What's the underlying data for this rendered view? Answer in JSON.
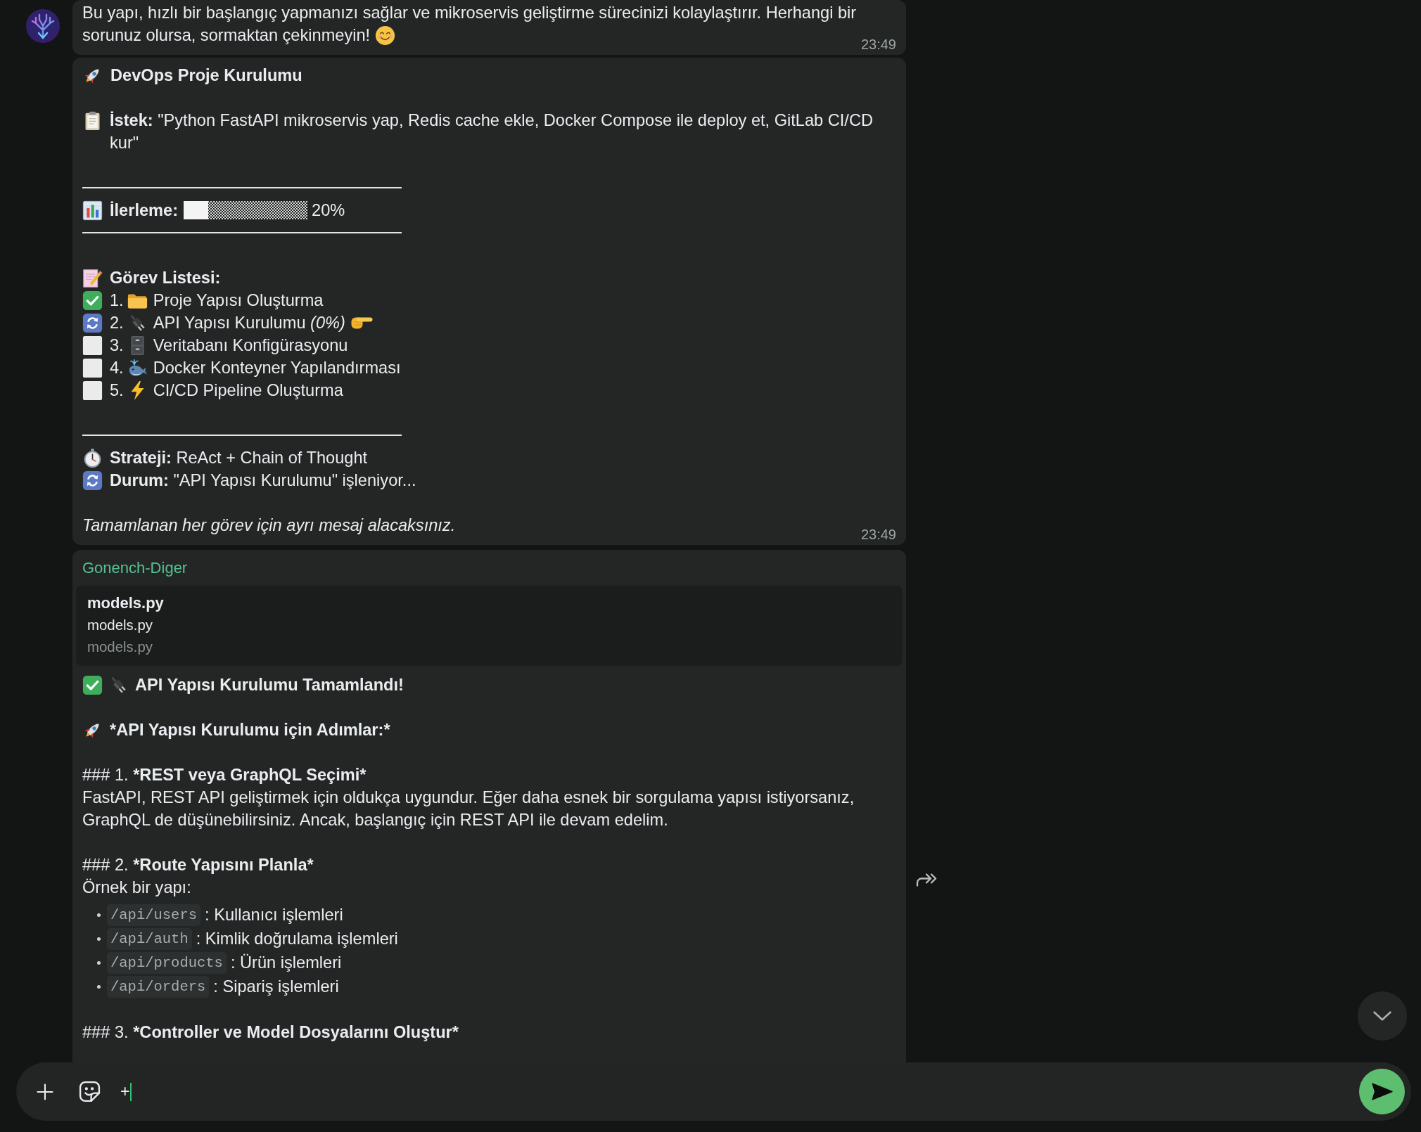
{
  "chat": {
    "intro_message": {
      "lines": [
        "Bu yapı, hızlı bir başlangıç yapmanızı sağlar ve mikroservis geliştirme sürecinizi kolaylaştırır. Herhangi bir",
        "sorunuz olursa, sormaktan çekinmeyin!"
      ],
      "time": "23:49"
    },
    "project_message": {
      "title": "DevOps Proje Kurulumu",
      "request": {
        "label": "İstek:",
        "text": "\"Python FastAPI mikroservis yap, Redis cache ekle, Docker Compose ile deploy et, GitLab CI/CD kur\""
      },
      "progress": {
        "label": "İlerleme:",
        "level": 0.2,
        "reading": "20%"
      },
      "tasks_title": "Görev Listesi:",
      "tasks": [
        {
          "number": "1.",
          "name": "Proje Yapısı Oluşturma",
          "kind": "done",
          "current": false
        },
        {
          "number": "2.",
          "name": "API Yapısı Kurulumu",
          "note": "(0%)",
          "kind": "in_progress",
          "current": true
        },
        {
          "number": "3.",
          "name": "Veritabanı Konfigürasyonu",
          "kind": "pending",
          "current": false
        },
        {
          "number": "4.",
          "name": "Docker Konteyner Yapılandırması",
          "kind": "pending",
          "current": false
        },
        {
          "number": "5.",
          "name": "CI/CD Pipeline Oluşturma",
          "kind": "pending",
          "current": false
        }
      ],
      "strategy": {
        "label": "Strateji:",
        "text": "ReAct + Chain of Thought"
      },
      "state": {
        "label": "Durum:",
        "text": "\"API Yapısı Kurulumu\" işleniyor..."
      },
      "footer": "Tamamlanan her görev için ayrı mesaj alacaksınız.",
      "time": "23:49"
    },
    "reply_message": {
      "sender": "Gonench-Diger",
      "attachment": {
        "title": "models.py",
        "subtitle": "models.py",
        "caption": "models.py"
      },
      "title": "API Yapısı Kurulumu Tamamlandı!",
      "subtitle": "*API Yapısı Kurulumu için Adımlar:*",
      "sections": [
        {
          "prefix": "### 1.",
          "title": "*REST veya GraphQL Seçimi*",
          "body": "FastAPI, REST API geliştirmek için oldukça uygundur. Eğer daha esnek bir sorgulama yapısı istiyorsanız, GraphQL de düşünebilirsiniz. Ancak, başlangıç için REST API ile devam edelim."
        },
        {
          "prefix": "### 2.",
          "title": "*Route Yapısını Planla*",
          "body": "Örnek bir yapı:",
          "items": [
            {
              "code": "/api/users",
              "text": ": Kullanıcı işlemleri"
            },
            {
              "code": "/api/auth",
              "text": ": Kimlik doğrulama işlemleri"
            },
            {
              "code": "/api/products",
              "text": ": Ürün işlemleri"
            },
            {
              "code": "/api/orders",
              "text": ": Sipariş işlemleri"
            }
          ]
        },
        {
          "prefix": "### 3.",
          "title": "*Controller ve Model Dosyalarını Oluştur*"
        }
      ]
    }
  },
  "composer": {
    "value": "+"
  }
}
